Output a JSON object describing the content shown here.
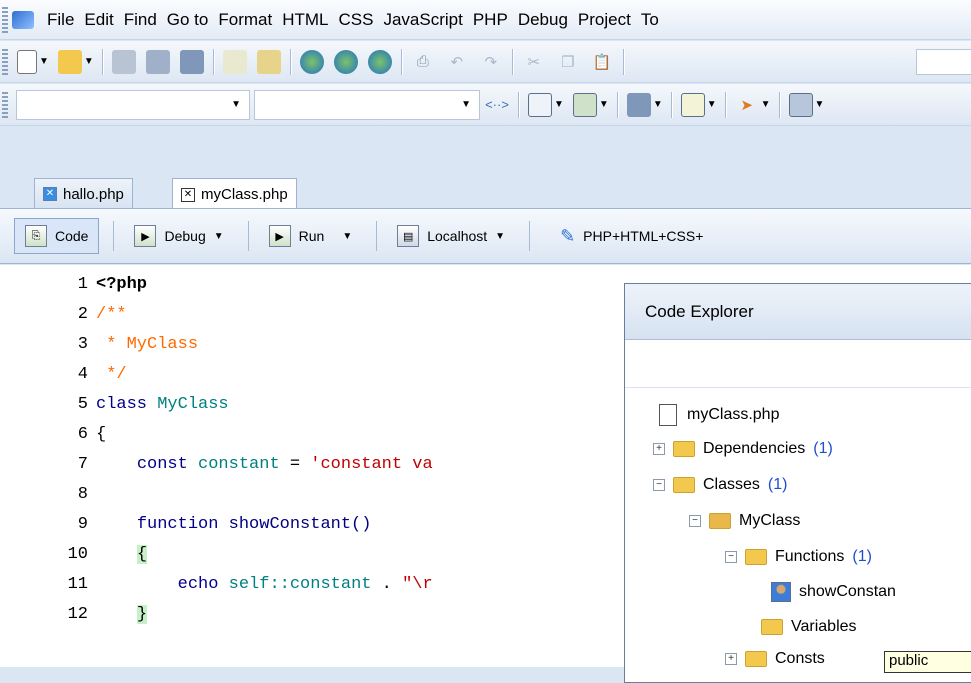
{
  "menubar": {
    "items": [
      "File",
      "Edit",
      "Find",
      "Go to",
      "Format",
      "HTML",
      "CSS",
      "JavaScript",
      "PHP",
      "Debug",
      "Project",
      "To"
    ]
  },
  "tabs": [
    {
      "label": "hallo.php"
    },
    {
      "label": "myClass.php"
    }
  ],
  "editor_toolbar": {
    "code": "Code",
    "debug": "Debug",
    "run": "Run",
    "localhost": "Localhost",
    "mode": "PHP+HTML+CSS+"
  },
  "code_lines": [
    {
      "num": "1",
      "text": "<?php"
    },
    {
      "num": "2",
      "text": "/**"
    },
    {
      "num": "3",
      "text": " * MyClass"
    },
    {
      "num": "4",
      "text": " */"
    },
    {
      "num": "5",
      "a": "class",
      "b": " MyClass"
    },
    {
      "num": "6",
      "text": "{"
    },
    {
      "num": "7",
      "a": "const",
      "b": " constant",
      "c": " = ",
      "d": "'constant va"
    },
    {
      "num": "8",
      "text": ""
    },
    {
      "num": "9",
      "a": "function",
      "b": " showConstant()"
    },
    {
      "num": "10",
      "text": "{"
    },
    {
      "num": "11",
      "a": "echo",
      "b": " self::",
      "c": "constant",
      "d": " . ",
      "e": "\"\\r"
    },
    {
      "num": "12",
      "text": "}"
    }
  ],
  "code_explorer": {
    "title": "Code Explorer",
    "file": "myClass.php",
    "dependencies": {
      "label": "Dependencies",
      "count": "(1)"
    },
    "classes": {
      "label": "Classes",
      "count": "(1)"
    },
    "myclass": "MyClass",
    "functions": {
      "label": "Functions",
      "count": "(1)"
    },
    "show_constant": "showConstan",
    "variables": "Variables",
    "consts": "Consts",
    "tooltip": "public"
  },
  "colors": {
    "accent": "#1f4fd1",
    "keyword": "#00008b",
    "comment": "#ff6a00",
    "string": "#c00000"
  }
}
